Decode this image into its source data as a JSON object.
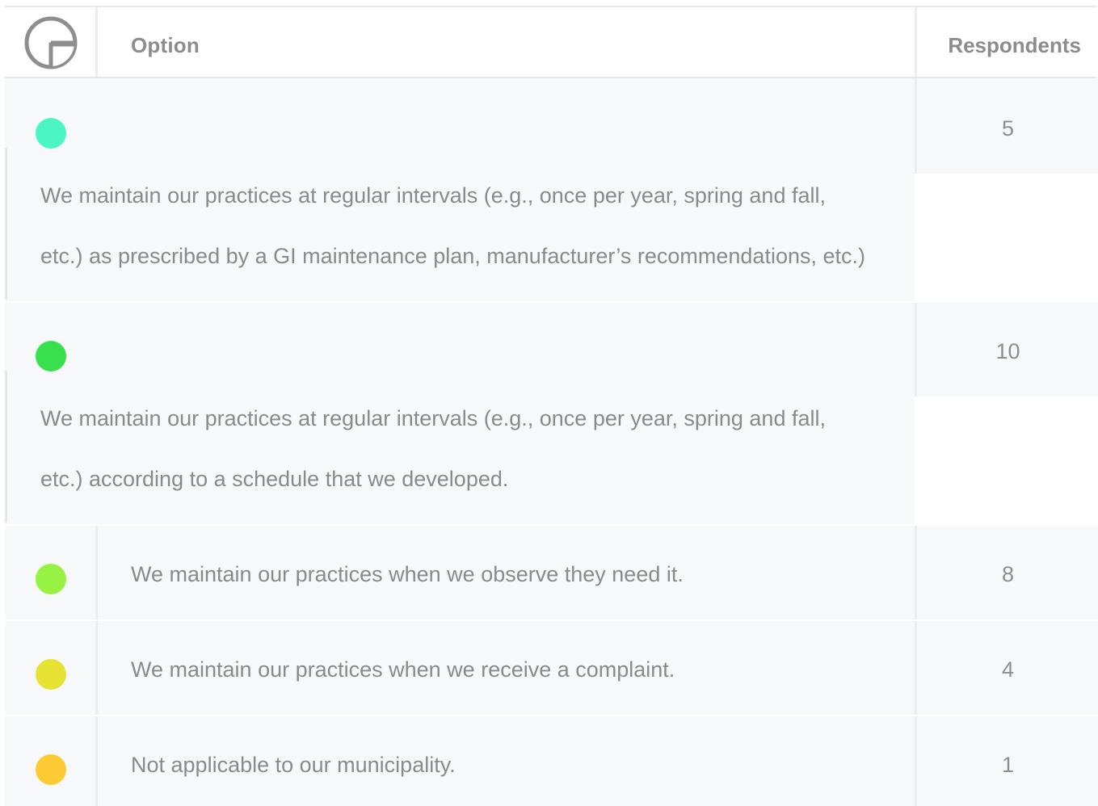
{
  "header": {
    "icon": "pie-chart-icon",
    "option_label": "Option",
    "respondents_label": "Respondents"
  },
  "rows": [
    {
      "color": "#4cf5c4",
      "text_line1": "We maintain our practices at regular intervals (e.g., once per year, spring and fall,",
      "text_line2": "etc.) as prescribed by a GI maintenance plan, manufacturer’s recommendations, etc.)",
      "count": "5"
    },
    {
      "color": "#38e04e",
      "text_line1": "We maintain our practices at regular intervals (e.g., once per year, spring and fall,",
      "text_line2": "etc.) according to a schedule that we developed.",
      "count": "10"
    },
    {
      "color": "#98f244",
      "text": "We maintain our practices when we observe they need it.",
      "count": "8"
    },
    {
      "color": "#e6e234",
      "text": "We maintain our practices when we receive a complaint.",
      "count": "4"
    },
    {
      "color": "#fccb34",
      "text": "Not applicable to our municipality.",
      "count": "1"
    }
  ]
}
